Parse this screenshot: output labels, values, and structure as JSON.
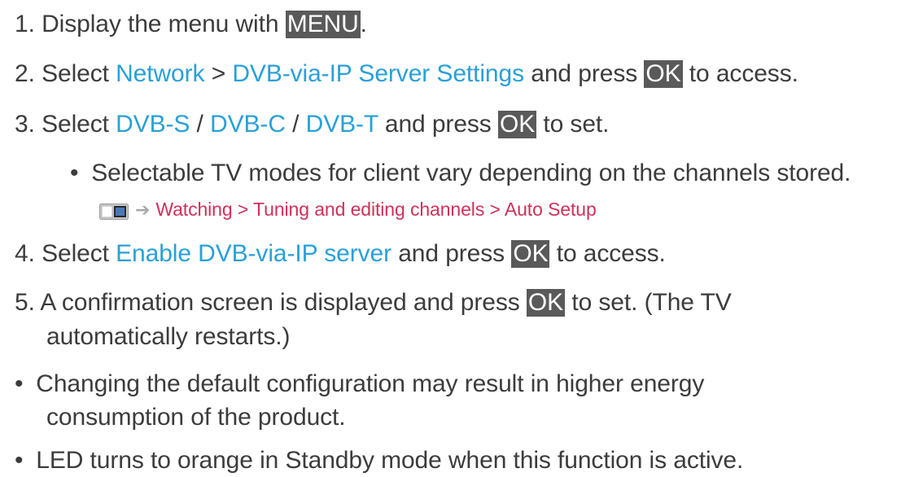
{
  "steps": {
    "s1": {
      "num": "1.",
      "pre": "Display the menu with",
      "key": "MENU",
      "post": "."
    },
    "s2": {
      "num": "2.",
      "pre": "Select",
      "link1": "Network",
      "sep": ">",
      "link2": "DVB-via-IP Server Settings",
      "mid": "and press",
      "key": "OK",
      "post": "to access."
    },
    "s3": {
      "num": "3.",
      "pre": "Select",
      "link1": "DVB-S",
      "sep1": "/",
      "link2": "DVB-C",
      "sep2": "/",
      "link3": "DVB-T",
      "mid": "and press",
      "key": "OK",
      "post": "to set."
    },
    "s3_note": {
      "bullet": "•",
      "text": "Selectable TV modes for client vary depending on the channels stored."
    },
    "s3_ref": {
      "text": "Watching > Tuning and editing channels > Auto Setup"
    },
    "s4": {
      "num": "4.",
      "pre": "Select",
      "link1": "Enable DVB-via-IP server",
      "mid": "and press",
      "key": "OK",
      "post": "to access."
    },
    "s5": {
      "num": "5.",
      "pre": "A confirmation screen is displayed and press",
      "key": "OK",
      "post": "to set. (The TV",
      "line2": "automatically restarts.)"
    }
  },
  "notes": {
    "n1": {
      "bullet": "•",
      "line1": "Changing the default configuration may result in higher energy",
      "line2": "consumption of the product."
    },
    "n2": {
      "bullet": "•",
      "text": "LED turns to orange in Standby mode when this function is active."
    }
  },
  "icons": {
    "reference": "tv-guide-book-icon",
    "arrow": "right-arrow-icon"
  }
}
